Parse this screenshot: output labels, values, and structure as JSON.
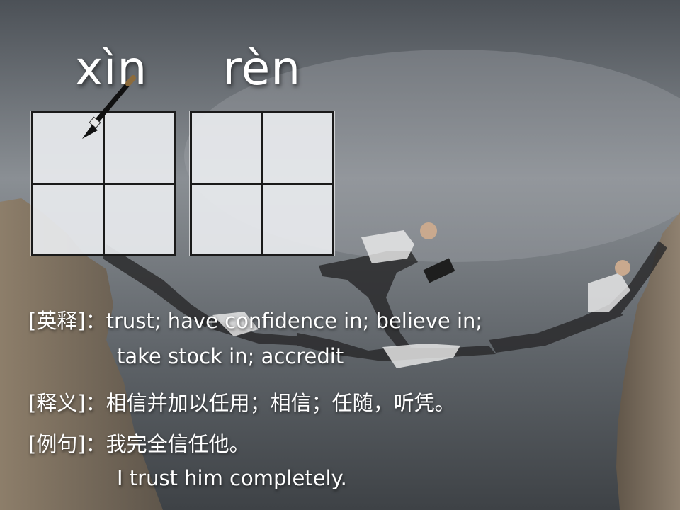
{
  "pinyin": [
    "xìn",
    "rèn"
  ],
  "definitions": {
    "english_label": "[英释]",
    "english_line1": "：trust; have confidence in; believe in;",
    "english_line2": "take stock in; accredit",
    "chinese_label": "[释义]",
    "chinese_text": "：相信并加以任用；相信；任随，听凭。",
    "example_label": "[例句]",
    "example_cn": "：我完全信任他。",
    "example_en": "I trust him completely."
  },
  "colors": {
    "text": "#ffffff",
    "grid_line": "#1a1a1a",
    "grid_fill": "#e8eaee"
  },
  "icons": {
    "brush": "calligraphy-brush-icon"
  }
}
